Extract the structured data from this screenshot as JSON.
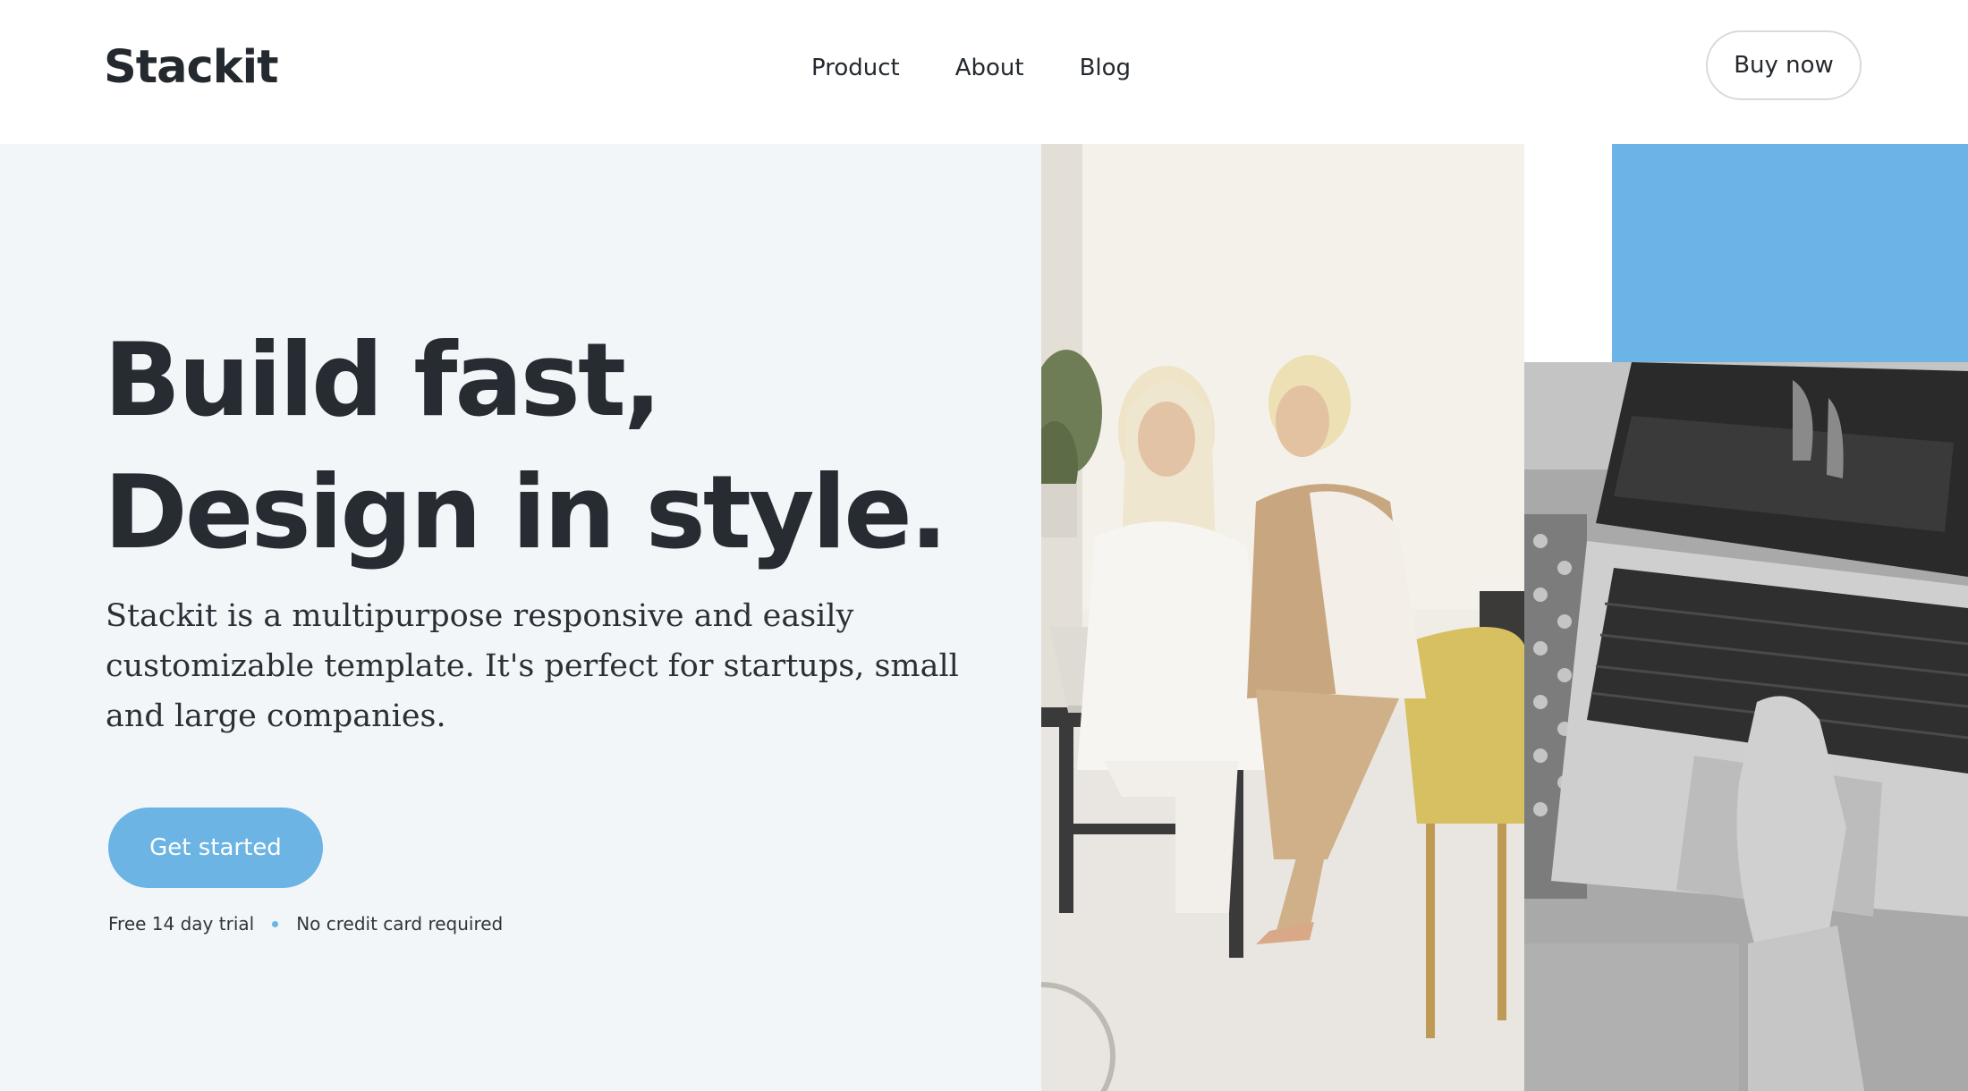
{
  "brand": {
    "name": "Stackit"
  },
  "nav": {
    "items": [
      "Product",
      "About",
      "Blog"
    ]
  },
  "header": {
    "cta_label": "Buy now"
  },
  "hero": {
    "headline_line1": "Build fast,",
    "headline_line2": "Design in style.",
    "description": "Stackit is a multipurpose responsive and easily customizable template. It's perfect for startups, small and large companies.",
    "cta_label": "Get started",
    "perks": [
      "Free 14 day trial",
      "No credit card required"
    ]
  },
  "colors": {
    "accent": "#6cb4e4",
    "hero_background": "#f3f6f9",
    "text": "#262c32"
  }
}
